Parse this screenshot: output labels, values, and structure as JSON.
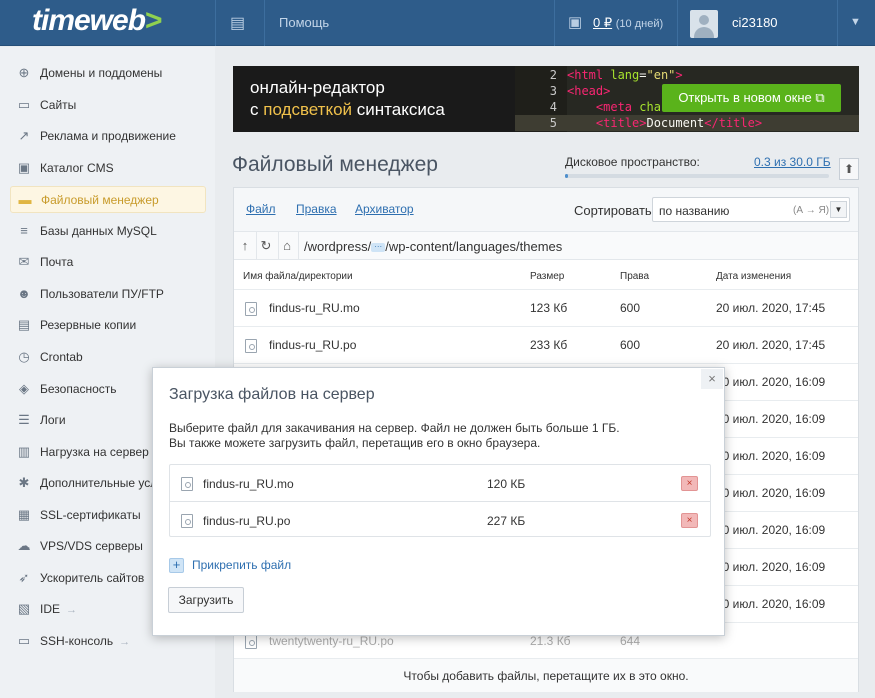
{
  "header": {
    "logo": "timeweb",
    "logo_chevron": ">",
    "help": "Помощь",
    "balance_amount": "0 ₽",
    "balance_days": "(10 дней)",
    "username": "ci23180",
    "caret": "▼"
  },
  "sidebar": {
    "items": [
      {
        "label": "Домены и поддомены",
        "icon": "globe-icon",
        "glyph": "⊕"
      },
      {
        "label": "Сайты",
        "icon": "site-icon",
        "glyph": "▭"
      },
      {
        "label": "Реклама и продвижение",
        "icon": "chart-icon",
        "glyph": "↗"
      },
      {
        "label": "Каталог CMS",
        "icon": "box-icon",
        "glyph": "▣"
      },
      {
        "label": "Файловый менеджер",
        "icon": "folder-icon",
        "glyph": "▬"
      },
      {
        "label": "Базы данных MySQL",
        "icon": "database-icon",
        "glyph": "≡"
      },
      {
        "label": "Почта",
        "icon": "mail-icon",
        "glyph": "✉"
      },
      {
        "label": "Пользователи ПУ/FTP",
        "icon": "users-icon",
        "glyph": "☻"
      },
      {
        "label": "Резервные копии",
        "icon": "backup-icon",
        "glyph": "▤"
      },
      {
        "label": "Crontab",
        "icon": "clock-icon",
        "glyph": "◷"
      },
      {
        "label": "Безопасность",
        "icon": "shield-icon",
        "glyph": "◈"
      },
      {
        "label": "Логи",
        "icon": "logs-icon",
        "glyph": "☰"
      },
      {
        "label": "Нагрузка на сервер",
        "icon": "load-icon",
        "glyph": "▥"
      },
      {
        "label": "Дополнительные усл",
        "icon": "gear-icon",
        "glyph": "✱"
      },
      {
        "label": "SSL-сертификаты",
        "icon": "certificate-icon",
        "glyph": "▦"
      },
      {
        "label": "VPS/VDS серверы",
        "icon": "cloud-icon",
        "glyph": "☁"
      },
      {
        "label": "Ускоритель сайтов",
        "icon": "rocket-icon",
        "glyph": "➶"
      },
      {
        "label": "IDE",
        "icon": "ide-icon",
        "glyph": "▧",
        "arrow": "→"
      },
      {
        "label": "SSH-консоль",
        "icon": "terminal-icon",
        "glyph": "▭",
        "arrow": "→"
      }
    ],
    "active_index": 4
  },
  "banner": {
    "line1": "онлайн-редактор",
    "line2_pre": "с ",
    "line2_highlight": "подсветкой",
    "line2_post": " синтаксиса",
    "button": "Открыть в новом окне ⧉",
    "code_lines": [
      {
        "n": "2",
        "html": "<span class=\"tg\">&lt;html</span> <span class=\"at\">lang</span><span class=\"tx\">=</span><span class=\"st\">\"en\"</span><span class=\"tg\">&gt;</span>"
      },
      {
        "n": "3",
        "html": "<span class=\"tg\">&lt;head&gt;</span>"
      },
      {
        "n": "4",
        "html": "&nbsp;&nbsp;&nbsp;&nbsp;<span class=\"tg\">&lt;meta</span> <span class=\"at\">cha</span>"
      },
      {
        "n": "5",
        "html": "&nbsp;&nbsp;&nbsp;&nbsp;<span class=\"tg\">&lt;title&gt;</span><span class=\"tx\">Document</span><span class=\"tg\">&lt;/title&gt;</span>"
      }
    ]
  },
  "page": {
    "title": "Файловый менеджер",
    "disk_label": "Дисковое пространство:",
    "disk_value": "0.3 из 30.0 ГБ",
    "disk_used_fraction": 0.01,
    "up_button": "⬆"
  },
  "fm": {
    "menu": [
      "Файл",
      "Правка",
      "Архиватор"
    ],
    "sort_label": "Сортировать:",
    "sort_value": "по названию",
    "sort_hint": "(А → Я)",
    "path_pre": "/wordpress/",
    "path_more": "···",
    "path_post": "/wp-content/languages/themes",
    "columns": [
      "Имя файла/директории",
      "Размер",
      "Права",
      "Дата изменения"
    ],
    "rows": [
      {
        "name": "findus-ru_RU.mo",
        "size": "123 Кб",
        "perm": "600",
        "date": "20 июл. 2020, 17:45"
      },
      {
        "name": "findus-ru_RU.po",
        "size": "233 Кб",
        "perm": "600",
        "date": "20 июл. 2020, 17:45"
      },
      {
        "name": "",
        "size": "",
        "perm": "",
        "date": "20 июл. 2020, 16:09"
      },
      {
        "name": "",
        "size": "",
        "perm": "",
        "date": "20 июл. 2020, 16:09"
      },
      {
        "name": "",
        "size": "",
        "perm": "",
        "date": "20 июл. 2020, 16:09"
      },
      {
        "name": "",
        "size": "",
        "perm": "",
        "date": "20 июл. 2020, 16:09"
      },
      {
        "name": "",
        "size": "",
        "perm": "",
        "date": "20 июл. 2020, 16:09"
      },
      {
        "name": "",
        "size": "",
        "perm": "",
        "date": "20 июл. 2020, 16:09"
      },
      {
        "name": "",
        "size": "",
        "perm": "",
        "date": "20 июл. 2020, 16:09"
      },
      {
        "name": "twentytwenty-ru_RU.po",
        "size": "21.3 Кб",
        "perm": "644",
        "date": ""
      }
    ],
    "drop_hint": "Чтобы добавить файлы, перетащите их в это окно."
  },
  "modal": {
    "title": "Загрузка файлов на сервер",
    "close": "×",
    "desc1": "Выберите файл для закачивания на сервер. Файл не должен быть больше 1 ГБ.",
    "desc2": "Вы также можете загрузить файл, перетащив его в окно браузера.",
    "files": [
      {
        "name": "findus-ru_RU.mo",
        "size": "120 КБ"
      },
      {
        "name": "findus-ru_RU.po",
        "size": "227 КБ"
      }
    ],
    "remove": "×",
    "attach": "Прикрепить файл",
    "upload": "Загрузить"
  },
  "colors": {
    "accent": "#2e5c8a",
    "green": "#5ab31b",
    "link": "#2e6fb0"
  }
}
